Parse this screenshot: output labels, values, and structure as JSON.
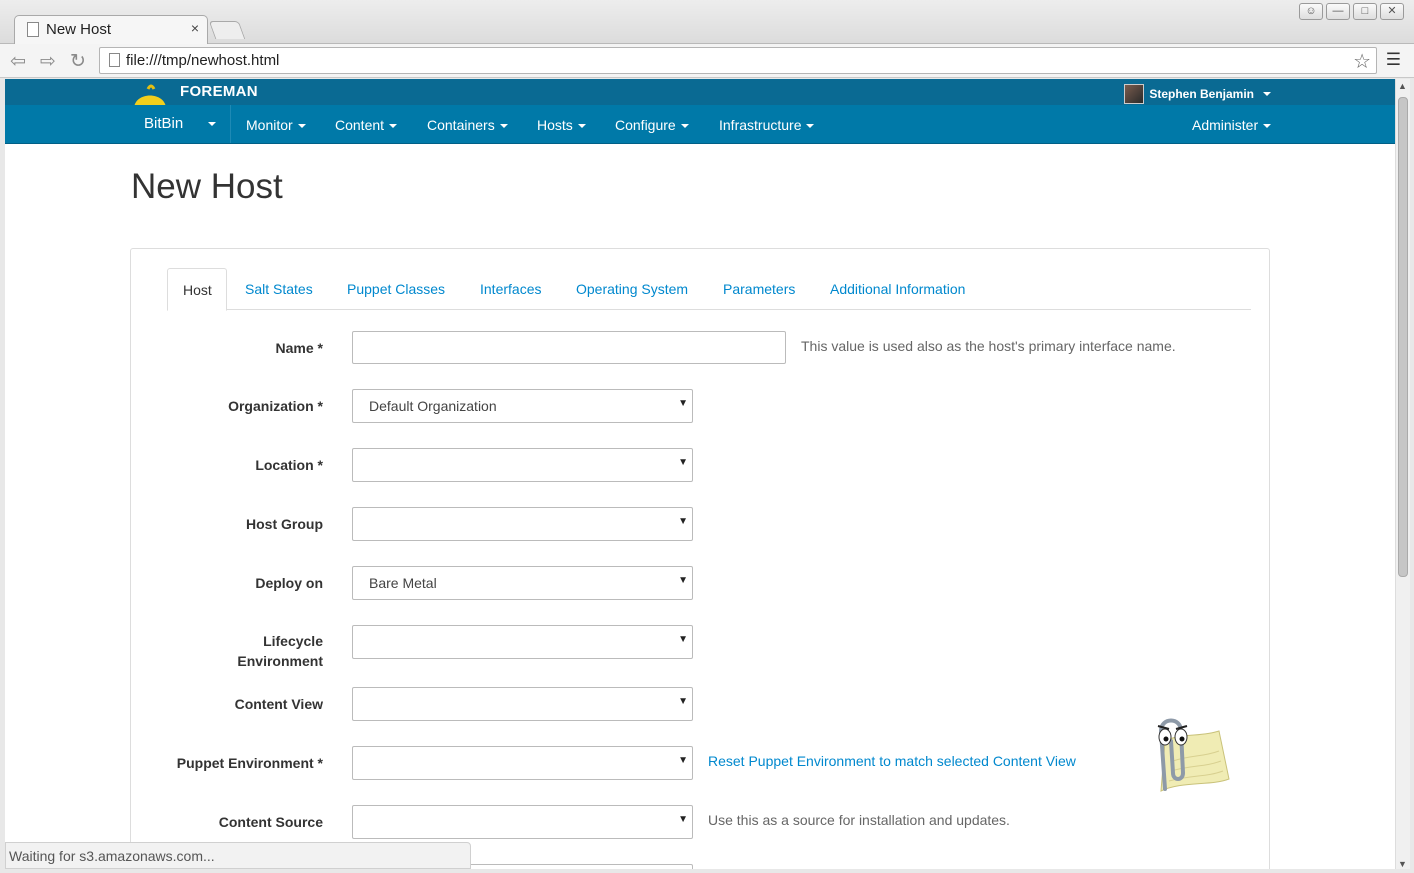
{
  "browser": {
    "tab_title": "New Host",
    "tab_close": "×",
    "url": "file:///tmp/newhost.html",
    "status_text": "Waiting for s3.amazonaws.com..."
  },
  "header": {
    "brand": "FOREMAN",
    "user_name": "Stephen Benjamin",
    "org": "BitBin",
    "menu": [
      "Monitor",
      "Content",
      "Containers",
      "Hosts",
      "Configure",
      "Infrastructure"
    ],
    "admin": "Administer"
  },
  "page": {
    "title": "New Host",
    "tabs": [
      "Host",
      "Salt States",
      "Puppet Classes",
      "Interfaces",
      "Operating System",
      "Parameters",
      "Additional Information"
    ],
    "fields": {
      "name": {
        "label": "Name *",
        "value": "",
        "help": "This value is used also as the host's primary interface name."
      },
      "organization": {
        "label": "Organization *",
        "value": "Default Organization"
      },
      "location": {
        "label": "Location *",
        "value": ""
      },
      "host_group": {
        "label": "Host Group",
        "value": ""
      },
      "deploy_on": {
        "label": "Deploy on",
        "value": "Bare Metal"
      },
      "lifecycle": {
        "label_line1": "Lifecycle",
        "label_line2": "Environment",
        "value": ""
      },
      "content_view": {
        "label": "Content View",
        "value": ""
      },
      "puppet_env": {
        "label": "Puppet Environment *",
        "value": "",
        "link": "Reset Puppet Environment to match selected Content View"
      },
      "content_source": {
        "label": "Content Source",
        "value": "",
        "help": "Use this as a source for installation and updates."
      }
    }
  },
  "colors": {
    "topbar": "#0a6a93",
    "menubar": "#0079a8",
    "link": "#0088ce"
  }
}
